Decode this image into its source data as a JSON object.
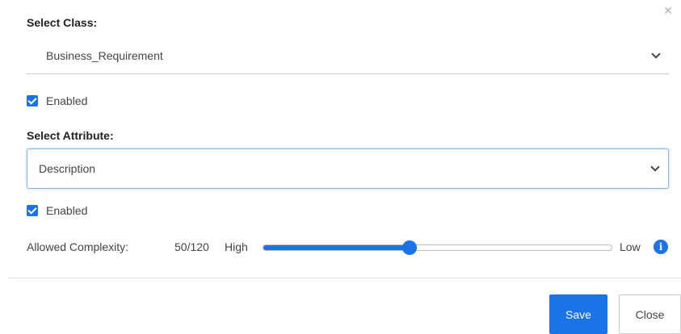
{
  "dialog": {
    "close_icon": "close-icon"
  },
  "class_section": {
    "label": "Select Class:",
    "selected_value": "Business_Requirement",
    "enabled_label": "Enabled",
    "enabled_checked": true
  },
  "attribute_section": {
    "label": "Select Attribute:",
    "selected_value": "Description",
    "enabled_label": "Enabled",
    "enabled_checked": true
  },
  "complexity": {
    "label": "Allowed Complexity:",
    "value_text": "50/120",
    "high_label": "High",
    "low_label": "Low",
    "value": 50,
    "max": 120,
    "slider_fraction": 0.42,
    "info_icon": "info-icon",
    "info_glyph": "i"
  },
  "footer": {
    "save_label": "Save",
    "close_label": "Close"
  },
  "colors": {
    "accent": "#1a73e8",
    "focus_border": "#8ab4e8"
  }
}
